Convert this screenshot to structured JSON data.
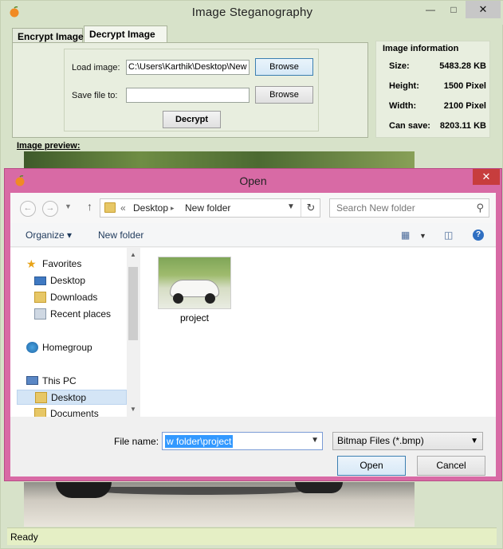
{
  "app": {
    "title": "Image  Steganography",
    "tabs": [
      "Encrypt Image",
      "Decrypt Image"
    ],
    "load_image_label": "Load image:",
    "load_image_value": "C:\\Users\\Karthik\\Desktop\\New",
    "save_file_label": "Save file to:",
    "save_file_value": "",
    "browse_label": "Browse",
    "decrypt_label": "Decrypt",
    "preview_label": "Image preview:",
    "status": "Ready",
    "window_controls": {
      "minimize": "—",
      "maximize": "□",
      "close": "✕"
    }
  },
  "image_info": {
    "title": "Image information",
    "rows": [
      {
        "label": "Size:",
        "value": "5483.28 KB"
      },
      {
        "label": "Height:",
        "value": "1500 Pixel"
      },
      {
        "label": "Width:",
        "value": "2100 Pixel"
      },
      {
        "label": "Can save:",
        "value": "8203.11 KB"
      }
    ]
  },
  "dialog": {
    "title": "Open",
    "close": "✕",
    "breadcrumb": [
      "«",
      "Desktop",
      "▸",
      "New folder"
    ],
    "search_placeholder": "Search New folder",
    "toolbar": {
      "organize": "Organize ▾",
      "new_folder": "New folder"
    },
    "tree": [
      {
        "label": "Favorites",
        "icon": "star-icon"
      },
      {
        "label": "Desktop",
        "icon": "desktop-icon"
      },
      {
        "label": "Downloads",
        "icon": "downloads-icon"
      },
      {
        "label": "Recent places",
        "icon": "recent-places-icon"
      },
      {
        "label": "Homegroup",
        "icon": "homegroup-icon"
      },
      {
        "label": "This PC",
        "icon": "this-pc-icon"
      },
      {
        "label": "Desktop",
        "icon": "desktop-icon"
      },
      {
        "label": "Documents",
        "icon": "documents-icon"
      }
    ],
    "file": {
      "name": "project"
    },
    "file_name_label": "File name:",
    "file_name_value": "w folder\\project",
    "file_type": "Bitmap Files (*.bmp)",
    "open_label": "Open",
    "cancel_label": "Cancel"
  },
  "colors": {
    "app_bg": "#d7e2c9",
    "dialog_frame": "#d86aa5",
    "close_red": "#c73d3d",
    "selection": "#3399ff"
  }
}
